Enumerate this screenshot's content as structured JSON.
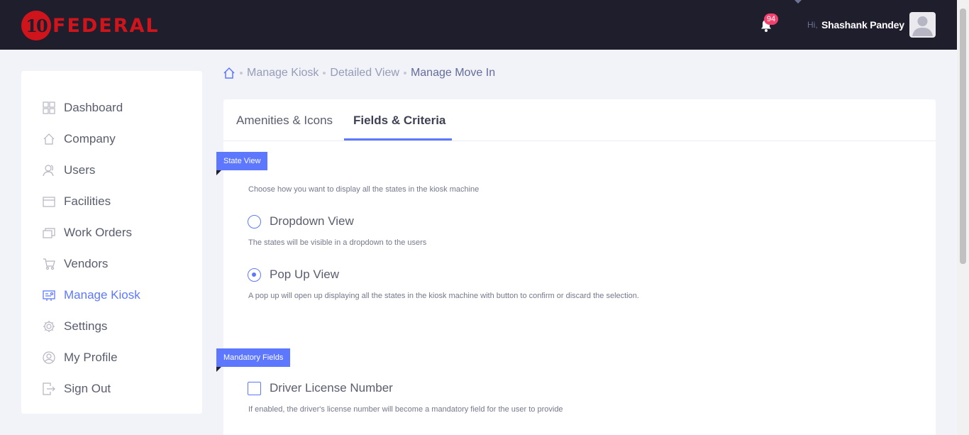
{
  "brand": {
    "logo_number": "10",
    "logo_text": "FEDERAL"
  },
  "header": {
    "notification_count": "94",
    "greeting": "Hi,",
    "user_name": "Shashank Pandey"
  },
  "sidebar": {
    "items": [
      {
        "label": "Dashboard",
        "icon": "dashboard-icon"
      },
      {
        "label": "Company",
        "icon": "home-icon"
      },
      {
        "label": "Users",
        "icon": "users-icon"
      },
      {
        "label": "Facilities",
        "icon": "facilities-icon"
      },
      {
        "label": "Work Orders",
        "icon": "work-orders-icon"
      },
      {
        "label": "Vendors",
        "icon": "cart-icon"
      },
      {
        "label": "Manage Kiosk",
        "icon": "kiosk-icon",
        "active": true
      },
      {
        "label": "Settings",
        "icon": "gear-icon"
      },
      {
        "label": "My Profile",
        "icon": "profile-icon"
      },
      {
        "label": "Sign Out",
        "icon": "sign-out-icon"
      }
    ]
  },
  "breadcrumb": {
    "items": [
      "Manage Kiosk",
      "Detailed View"
    ],
    "current": "Manage Move In"
  },
  "tabs": {
    "items": [
      "Amenities & Icons",
      "Fields & Criteria"
    ],
    "active": "Fields & Criteria"
  },
  "state_view": {
    "title": "State View",
    "description": "Choose how you want to display all the states in the kiosk machine",
    "options": [
      {
        "label": "Dropdown View",
        "description": "The states will be visible in a dropdown to the users",
        "checked": false
      },
      {
        "label": "Pop Up View",
        "description": "A pop up will open up displaying all the states in the kiosk machine with button to confirm or discard the selection.",
        "checked": true
      }
    ]
  },
  "mandatory_fields": {
    "title": "Mandatory Fields",
    "options": [
      {
        "label": "Driver License Number",
        "description": "If enabled, the driver's license number will become a mandatory field for the user to provide",
        "checked": false
      }
    ]
  },
  "colors": {
    "accent": "#5d78ff",
    "topbar": "#1e1e2d",
    "brand_red": "#d0141c",
    "badge": "#f1416c"
  }
}
